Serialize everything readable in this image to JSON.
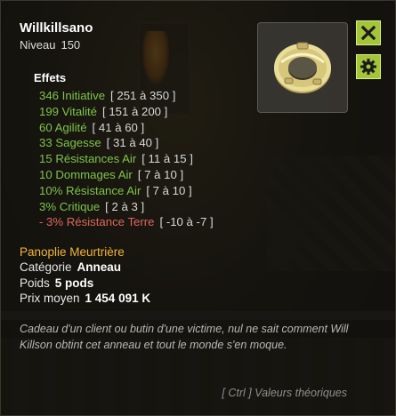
{
  "item": {
    "name": "Willkillsano",
    "level_label": "Niveau",
    "level": "150",
    "icon": "gold-ring-icon"
  },
  "buttons": {
    "close_icon": "close-icon",
    "settings_icon": "gear-icon",
    "accent_color": "#a4c43a"
  },
  "effects": {
    "heading": "Effets",
    "items": [
      {
        "text": "346 Initiative",
        "range": "[ 251 à 350 ]",
        "negative": false
      },
      {
        "text": "199 Vitalité",
        "range": "[ 151 à 200 ]",
        "negative": false
      },
      {
        "text": "60 Agilité",
        "range": "[ 41 à 60 ]",
        "negative": false
      },
      {
        "text": "33 Sagesse",
        "range": "[ 31 à 40 ]",
        "negative": false
      },
      {
        "text": "15 Résistances Air",
        "range": "[ 11 à 15 ]",
        "negative": false
      },
      {
        "text": "10 Dommages Air",
        "range": "[ 7 à 10 ]",
        "negative": false
      },
      {
        "text": "10% Résistance Air",
        "range": "[ 7 à 10 ]",
        "negative": false
      },
      {
        "text": "3% Critique",
        "range": "[ 2 à 3 ]",
        "negative": false
      },
      {
        "text": "- 3% Résistance Terre",
        "range": "[ -10 à -7 ]",
        "negative": true
      }
    ],
    "positive_color": "#7ec44a",
    "negative_color": "#e0665a"
  },
  "set": {
    "name": "Panoplie Meurtrière",
    "color": "#f2b634"
  },
  "properties": {
    "category_label": "Catégorie",
    "category_value": "Anneau",
    "weight_label": "Poids",
    "weight_value": "5 pods",
    "price_label": "Prix moyen",
    "price_value": "1 454 091 K"
  },
  "description": "Cadeau d'un client ou butin d'une victime, nul ne sait comment Will Killson obtint cet anneau et tout le monde s'en moque.",
  "footer_hint": "[ Ctrl ] Valeurs théoriques"
}
